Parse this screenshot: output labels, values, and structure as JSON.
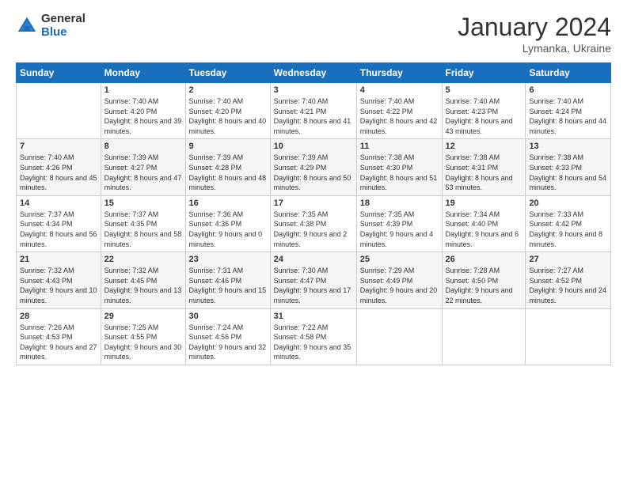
{
  "header": {
    "logo_general": "General",
    "logo_blue": "Blue",
    "title": "January 2024",
    "location": "Lymanka, Ukraine"
  },
  "days_of_week": [
    "Sunday",
    "Monday",
    "Tuesday",
    "Wednesday",
    "Thursday",
    "Friday",
    "Saturday"
  ],
  "weeks": [
    [
      {
        "day": "",
        "sunrise": "",
        "sunset": "",
        "daylight": ""
      },
      {
        "day": "1",
        "sunrise": "Sunrise: 7:40 AM",
        "sunset": "Sunset: 4:20 PM",
        "daylight": "Daylight: 8 hours and 39 minutes."
      },
      {
        "day": "2",
        "sunrise": "Sunrise: 7:40 AM",
        "sunset": "Sunset: 4:20 PM",
        "daylight": "Daylight: 8 hours and 40 minutes."
      },
      {
        "day": "3",
        "sunrise": "Sunrise: 7:40 AM",
        "sunset": "Sunset: 4:21 PM",
        "daylight": "Daylight: 8 hours and 41 minutes."
      },
      {
        "day": "4",
        "sunrise": "Sunrise: 7:40 AM",
        "sunset": "Sunset: 4:22 PM",
        "daylight": "Daylight: 8 hours and 42 minutes."
      },
      {
        "day": "5",
        "sunrise": "Sunrise: 7:40 AM",
        "sunset": "Sunset: 4:23 PM",
        "daylight": "Daylight: 8 hours and 43 minutes."
      },
      {
        "day": "6",
        "sunrise": "Sunrise: 7:40 AM",
        "sunset": "Sunset: 4:24 PM",
        "daylight": "Daylight: 8 hours and 44 minutes."
      }
    ],
    [
      {
        "day": "7",
        "sunrise": "Sunrise: 7:40 AM",
        "sunset": "Sunset: 4:26 PM",
        "daylight": "Daylight: 8 hours and 45 minutes."
      },
      {
        "day": "8",
        "sunrise": "Sunrise: 7:39 AM",
        "sunset": "Sunset: 4:27 PM",
        "daylight": "Daylight: 8 hours and 47 minutes."
      },
      {
        "day": "9",
        "sunrise": "Sunrise: 7:39 AM",
        "sunset": "Sunset: 4:28 PM",
        "daylight": "Daylight: 8 hours and 48 minutes."
      },
      {
        "day": "10",
        "sunrise": "Sunrise: 7:39 AM",
        "sunset": "Sunset: 4:29 PM",
        "daylight": "Daylight: 8 hours and 50 minutes."
      },
      {
        "day": "11",
        "sunrise": "Sunrise: 7:38 AM",
        "sunset": "Sunset: 4:30 PM",
        "daylight": "Daylight: 8 hours and 51 minutes."
      },
      {
        "day": "12",
        "sunrise": "Sunrise: 7:38 AM",
        "sunset": "Sunset: 4:31 PM",
        "daylight": "Daylight: 8 hours and 53 minutes."
      },
      {
        "day": "13",
        "sunrise": "Sunrise: 7:38 AM",
        "sunset": "Sunset: 4:33 PM",
        "daylight": "Daylight: 8 hours and 54 minutes."
      }
    ],
    [
      {
        "day": "14",
        "sunrise": "Sunrise: 7:37 AM",
        "sunset": "Sunset: 4:34 PM",
        "daylight": "Daylight: 8 hours and 56 minutes."
      },
      {
        "day": "15",
        "sunrise": "Sunrise: 7:37 AM",
        "sunset": "Sunset: 4:35 PM",
        "daylight": "Daylight: 8 hours and 58 minutes."
      },
      {
        "day": "16",
        "sunrise": "Sunrise: 7:36 AM",
        "sunset": "Sunset: 4:36 PM",
        "daylight": "Daylight: 9 hours and 0 minutes."
      },
      {
        "day": "17",
        "sunrise": "Sunrise: 7:35 AM",
        "sunset": "Sunset: 4:38 PM",
        "daylight": "Daylight: 9 hours and 2 minutes."
      },
      {
        "day": "18",
        "sunrise": "Sunrise: 7:35 AM",
        "sunset": "Sunset: 4:39 PM",
        "daylight": "Daylight: 9 hours and 4 minutes."
      },
      {
        "day": "19",
        "sunrise": "Sunrise: 7:34 AM",
        "sunset": "Sunset: 4:40 PM",
        "daylight": "Daylight: 9 hours and 6 minutes."
      },
      {
        "day": "20",
        "sunrise": "Sunrise: 7:33 AM",
        "sunset": "Sunset: 4:42 PM",
        "daylight": "Daylight: 9 hours and 8 minutes."
      }
    ],
    [
      {
        "day": "21",
        "sunrise": "Sunrise: 7:32 AM",
        "sunset": "Sunset: 4:43 PM",
        "daylight": "Daylight: 9 hours and 10 minutes."
      },
      {
        "day": "22",
        "sunrise": "Sunrise: 7:32 AM",
        "sunset": "Sunset: 4:45 PM",
        "daylight": "Daylight: 9 hours and 13 minutes."
      },
      {
        "day": "23",
        "sunrise": "Sunrise: 7:31 AM",
        "sunset": "Sunset: 4:46 PM",
        "daylight": "Daylight: 9 hours and 15 minutes."
      },
      {
        "day": "24",
        "sunrise": "Sunrise: 7:30 AM",
        "sunset": "Sunset: 4:47 PM",
        "daylight": "Daylight: 9 hours and 17 minutes."
      },
      {
        "day": "25",
        "sunrise": "Sunrise: 7:29 AM",
        "sunset": "Sunset: 4:49 PM",
        "daylight": "Daylight: 9 hours and 20 minutes."
      },
      {
        "day": "26",
        "sunrise": "Sunrise: 7:28 AM",
        "sunset": "Sunset: 4:50 PM",
        "daylight": "Daylight: 9 hours and 22 minutes."
      },
      {
        "day": "27",
        "sunrise": "Sunrise: 7:27 AM",
        "sunset": "Sunset: 4:52 PM",
        "daylight": "Daylight: 9 hours and 24 minutes."
      }
    ],
    [
      {
        "day": "28",
        "sunrise": "Sunrise: 7:26 AM",
        "sunset": "Sunset: 4:53 PM",
        "daylight": "Daylight: 9 hours and 27 minutes."
      },
      {
        "day": "29",
        "sunrise": "Sunrise: 7:25 AM",
        "sunset": "Sunset: 4:55 PM",
        "daylight": "Daylight: 9 hours and 30 minutes."
      },
      {
        "day": "30",
        "sunrise": "Sunrise: 7:24 AM",
        "sunset": "Sunset: 4:56 PM",
        "daylight": "Daylight: 9 hours and 32 minutes."
      },
      {
        "day": "31",
        "sunrise": "Sunrise: 7:22 AM",
        "sunset": "Sunset: 4:58 PM",
        "daylight": "Daylight: 9 hours and 35 minutes."
      },
      {
        "day": "",
        "sunrise": "",
        "sunset": "",
        "daylight": ""
      },
      {
        "day": "",
        "sunrise": "",
        "sunset": "",
        "daylight": ""
      },
      {
        "day": "",
        "sunrise": "",
        "sunset": "",
        "daylight": ""
      }
    ]
  ]
}
